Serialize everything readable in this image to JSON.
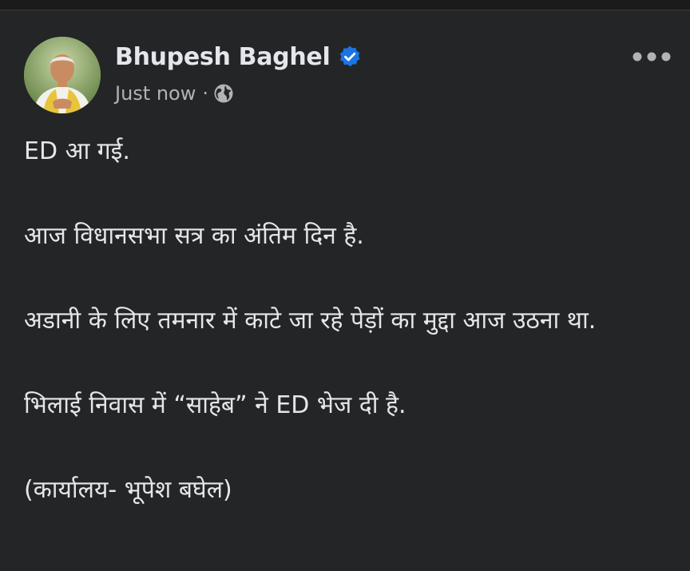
{
  "post": {
    "author": "Bhupesh Baghel",
    "timestamp": "Just now",
    "separator": "·",
    "audience_icon": "globe-icon",
    "verified_icon": "verified-badge-icon",
    "more_icon": "more-options-icon",
    "paragraphs": [
      "ED आ गई.",
      "आज विधानसभा सत्र का अंतिम दिन है.",
      "अडानी के लिए तमनार में काटे जा रहे पेड़ों का मुद्दा आज उठना था.",
      "भिलाई निवास में “साहेब” ने ED भेज दी है.",
      "(कार्यालय- भूपेश बघेल)"
    ]
  },
  "colors": {
    "background": "#242526",
    "text": "#e4e6eb",
    "secondary_text": "#b0b3b8",
    "verified_blue": "#1b74e4"
  }
}
